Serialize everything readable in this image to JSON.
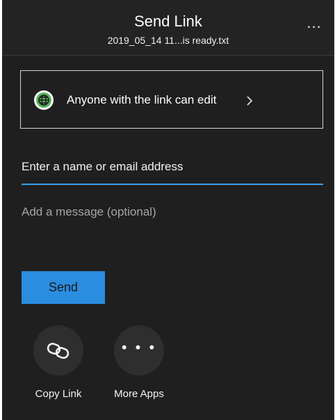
{
  "header": {
    "title": "Send Link",
    "file_name": "2019_05_14 11...is ready.txt",
    "more_options_label": "..."
  },
  "permissions": {
    "text": "Anyone with the link can edit",
    "icon": "globe-icon",
    "chevron": "chevron-right-icon"
  },
  "recipient": {
    "placeholder": "Enter a name or email address",
    "value": ""
  },
  "message": {
    "placeholder": "Add a message (optional)",
    "value": ""
  },
  "send_button": {
    "label": "Send"
  },
  "share_targets": [
    {
      "label": "Copy Link",
      "icon": "link-icon"
    },
    {
      "label": "More Apps",
      "icon": "more-dots-icon",
      "glyph": "• • •"
    }
  ],
  "colors": {
    "background": "#1f1f1f",
    "accent": "#2b8de0",
    "input_underline": "#3aa0f0",
    "globe": "#57b35a"
  }
}
